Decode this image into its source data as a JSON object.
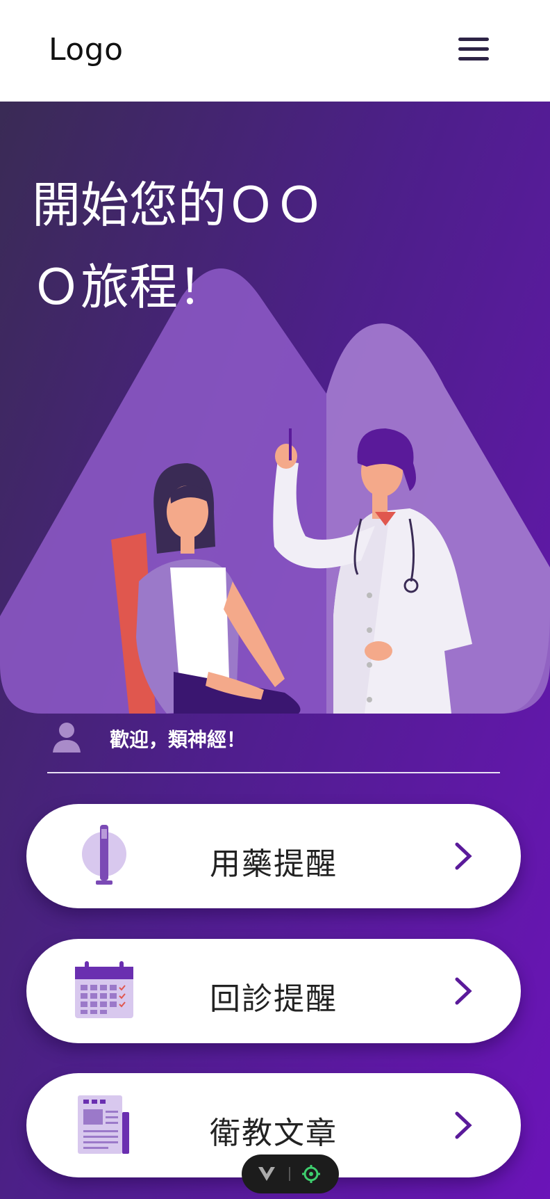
{
  "header": {
    "logo": "Logo",
    "menu_icon": "hamburger-icon"
  },
  "hero": {
    "title": "開始您的ＯＯＯ旅程！"
  },
  "welcome": {
    "icon": "user-avatar-icon",
    "text": "歡迎，類神經！"
  },
  "cards": [
    {
      "label": "用藥提醒",
      "icon": "injection-pen-icon",
      "chevron": "chevron-right-icon"
    },
    {
      "label": "回診提醒",
      "icon": "calendar-icon",
      "chevron": "chevron-right-icon"
    },
    {
      "label": "衛教文章",
      "icon": "newspaper-icon",
      "chevron": "chevron-right-icon"
    }
  ],
  "dev_toolbar": {
    "icons": [
      "vue-logo-icon",
      "target-icon"
    ]
  },
  "colors": {
    "accent": "#5a1a9a",
    "gradient_start": "#3a2b55",
    "gradient_end": "#6b14b8",
    "card_bg": "#ffffff"
  }
}
